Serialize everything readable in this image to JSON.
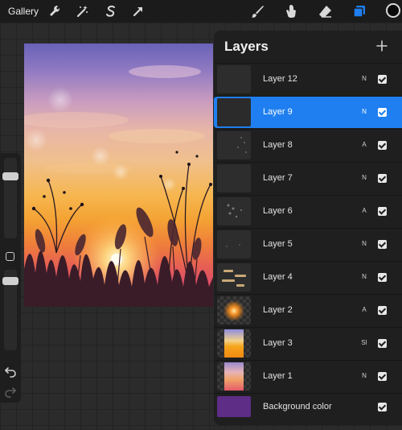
{
  "topbar": {
    "gallery_label": "Gallery",
    "tools": [
      {
        "icon": "wrench-icon"
      },
      {
        "icon": "magic-wand-icon"
      },
      {
        "icon": "selection-icon"
      },
      {
        "icon": "transform-arrow-icon"
      },
      {
        "icon": "brush-icon"
      },
      {
        "icon": "smudge-icon"
      },
      {
        "icon": "eraser-icon"
      },
      {
        "icon": "layers-icon",
        "active": true
      }
    ],
    "color_swatch": "#0a0a0a"
  },
  "panel": {
    "title": "Layers",
    "add_icon": "plus-icon",
    "layers": [
      {
        "name": "Layer 12",
        "blend": "N",
        "visible": true
      },
      {
        "name": "Layer 9",
        "blend": "N",
        "visible": true,
        "selected": true
      },
      {
        "name": "Layer 8",
        "blend": "A",
        "visible": true
      },
      {
        "name": "Layer 7",
        "blend": "N",
        "visible": true
      },
      {
        "name": "Layer 6",
        "blend": "A",
        "visible": true
      },
      {
        "name": "Layer 5",
        "blend": "N",
        "visible": true
      },
      {
        "name": "Layer 4",
        "blend": "N",
        "visible": true
      },
      {
        "name": "Layer 2",
        "blend": "A",
        "visible": true
      },
      {
        "name": "Layer 3",
        "blend": "SI",
        "visible": true
      },
      {
        "name": "Layer 1",
        "blend": "N",
        "visible": true
      },
      {
        "name": "Background color",
        "blend": "",
        "visible": true
      }
    ]
  },
  "colors": {
    "accent": "#1f7ff0",
    "background_layer": "#5e2d86"
  }
}
